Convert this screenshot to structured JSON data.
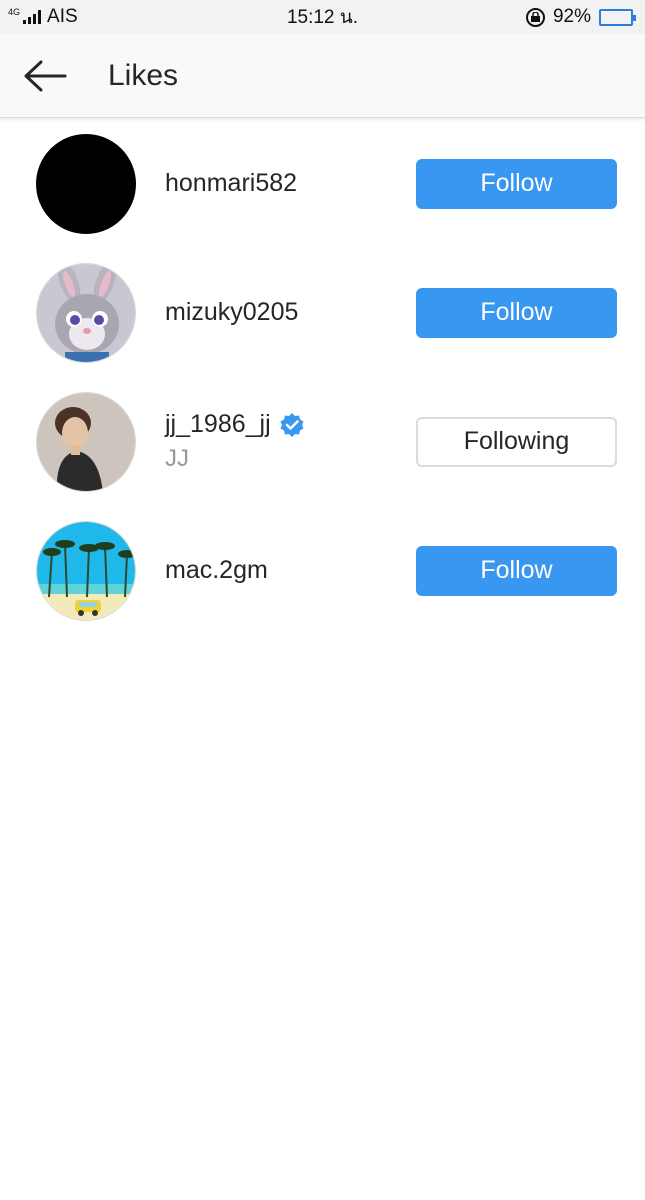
{
  "status_bar": {
    "network": "4G",
    "carrier": "AIS",
    "time": "15:12 น.",
    "battery": "92%",
    "battery_level": 0.92
  },
  "header": {
    "title": "Likes"
  },
  "likes": [
    {
      "username": "honmari582",
      "full_name": "",
      "verified": false,
      "button": "Follow",
      "state": "follow"
    },
    {
      "username": "mizuky0205",
      "full_name": "",
      "verified": false,
      "button": "Follow",
      "state": "follow"
    },
    {
      "username": "jj_1986_jj",
      "full_name": "JJ",
      "verified": true,
      "button": "Following",
      "state": "following"
    },
    {
      "username": "mac.2gm",
      "full_name": "",
      "verified": false,
      "button": "Follow",
      "state": "follow"
    }
  ],
  "colors": {
    "follow_button": "#3897f0",
    "verified_badge": "#3897f0"
  }
}
